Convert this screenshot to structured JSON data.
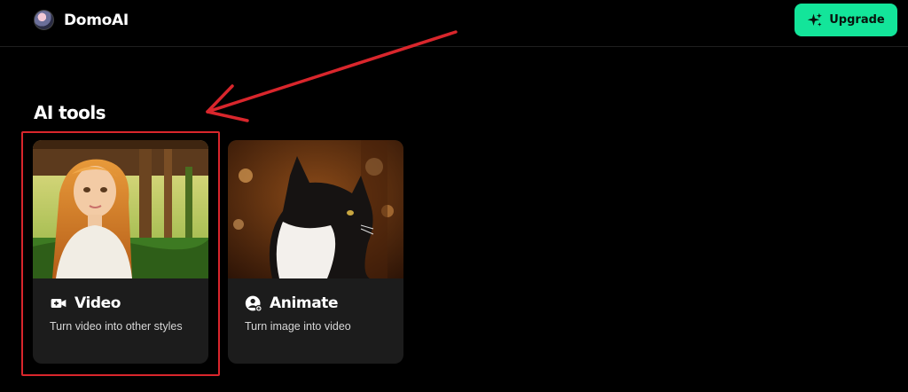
{
  "header": {
    "brand_name": "DomoAI",
    "upgrade_label": "Upgrade"
  },
  "section": {
    "title": "AI tools"
  },
  "tools": [
    {
      "title": "Video",
      "description": "Turn video into other styles",
      "icon": "video-camera-icon"
    },
    {
      "title": "Animate",
      "description": "Turn image into video",
      "icon": "animate-user-icon"
    }
  ],
  "colors": {
    "accent": "#13e59a",
    "annotation": "#d9262c",
    "background": "#000000",
    "card": "#1c1c1c"
  }
}
